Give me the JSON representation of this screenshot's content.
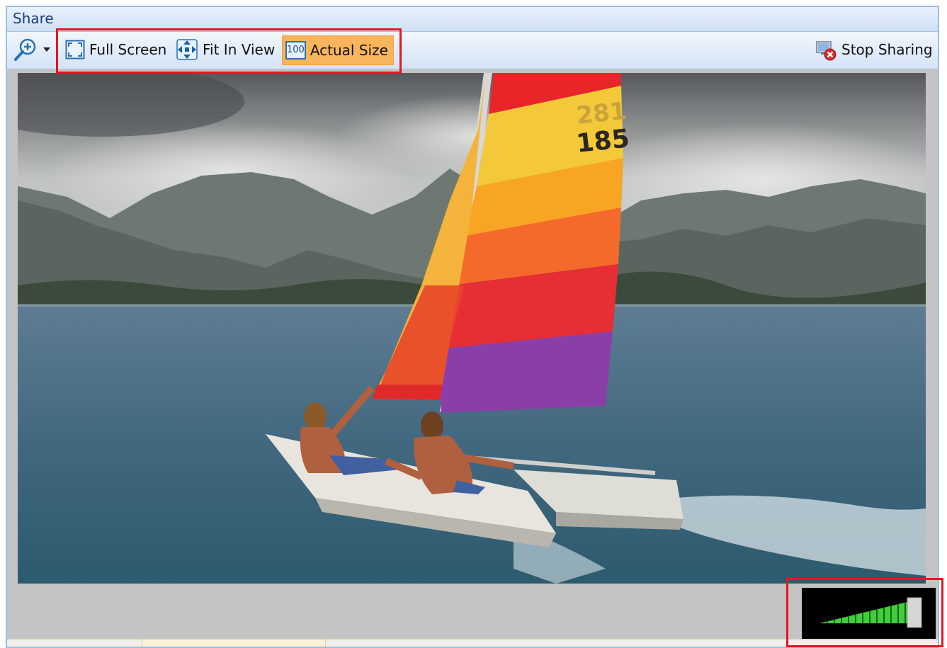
{
  "window": {
    "title": "Share"
  },
  "toolbar": {
    "zoom_icon": "zoom-in-icon",
    "zoom_dropdown_icon": "chevron-down-icon",
    "full_screen_label": "Full Screen",
    "fit_in_view_label": "Fit In View",
    "actual_size_icon_text": "100",
    "actual_size_label": "Actual Size",
    "stop_sharing_label": "Stop Sharing",
    "active_button": "actual_size"
  },
  "video": {
    "sail_numbers": [
      "281",
      "185"
    ]
  },
  "volume": {
    "level": 0.95
  },
  "colors": {
    "title_text": "#1b3e7a",
    "active_button_bg": "#f9b55b",
    "highlight_border": "#e8141e",
    "volume_bar": "#3fcf3a"
  }
}
